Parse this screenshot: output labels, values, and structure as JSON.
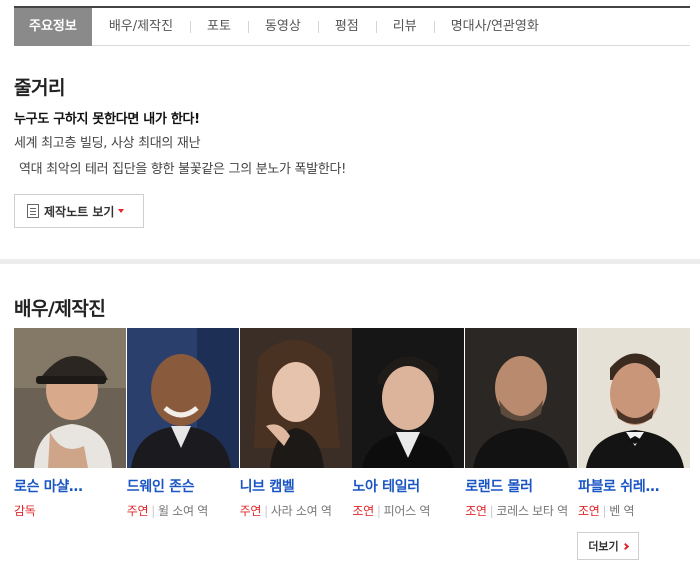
{
  "tabs": [
    {
      "label": "주요정보",
      "active": true
    },
    {
      "label": "배우/제작진"
    },
    {
      "label": "포토"
    },
    {
      "label": "동영상"
    },
    {
      "label": "평점"
    },
    {
      "label": "리뷰"
    },
    {
      "label": "명대사/연관영화"
    }
  ],
  "synopsis": {
    "title": "줄거리",
    "tagline": "누구도 구하지 못한다면 내가 한다!",
    "line1": "세계 최고층 빌딩, 사상 최대의 재난",
    "line2": "역대 최악의 테러 집단을 향한 불꽃같은 그의 분노가 폭발한다!",
    "note_button": "제작노트 보기"
  },
  "cast": {
    "title": "배우/제작진",
    "more_label": "더보기",
    "members": [
      {
        "name": "로슨 마샬…",
        "kind": "감독",
        "role": ""
      },
      {
        "name": "드웨인 존슨",
        "kind": "주연",
        "role": "윌 소여 역"
      },
      {
        "name": "니브 캠벨",
        "kind": "주연",
        "role": "사라 소여 역"
      },
      {
        "name": "노아 테일러",
        "kind": "조연",
        "role": "피어스 역"
      },
      {
        "name": "로랜드 몰러",
        "kind": "조연",
        "role": "코레스 보타 역"
      },
      {
        "name": "파블로 쉬레…",
        "kind": "조연",
        "role": "벤 역"
      }
    ]
  },
  "colors": {
    "accent_red": "#e0262a",
    "link_blue": "#1a55c4",
    "active_tab": "#8a8a8a"
  }
}
